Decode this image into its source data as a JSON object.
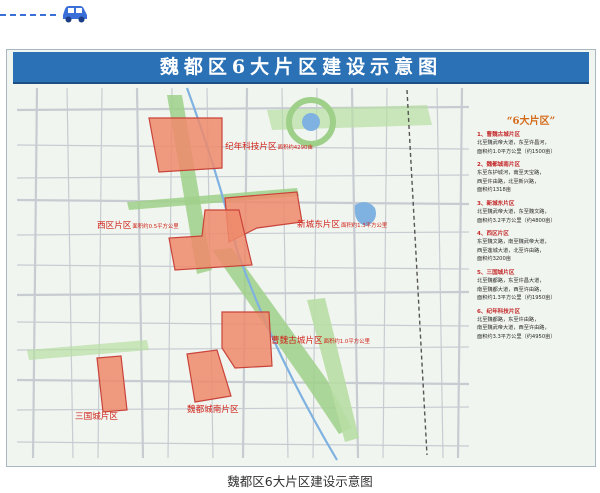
{
  "map": {
    "title": "魏都区6大片区建设示意图",
    "districts": [
      {
        "name": "纪年科技片区",
        "area_note": "面积约4290亩"
      },
      {
        "name": "西区片区",
        "area_note": "面积约0.5平方公里"
      },
      {
        "name": "新城东片区",
        "area_note": "面积约1.3平方公里"
      },
      {
        "name": "曹魏古城片区",
        "area_note": "面积约1.0平方公里"
      },
      {
        "name": "三国城片区",
        "area_note": ""
      },
      {
        "name": "魏都城南片区",
        "area_note": ""
      }
    ],
    "legend": {
      "title": "“6大片区”",
      "items": [
        {
          "name": "1、曹魏古城片区",
          "lines": [
            "北至魏武帝大道，东至许昌河，",
            "面积约1.0平方公里（约1500亩）"
          ]
        },
        {
          "name": "2、魏都城南片区",
          "lines": [
            "东至东护城河，南至天宝路，",
            "西至许由路，北至新兴路，",
            "面积约1318亩"
          ]
        },
        {
          "name": "3、新城东片区",
          "lines": [
            "北至魏武帝大道，东至魏文路，",
            "面积约3.2平方公里（约4800亩）"
          ]
        },
        {
          "name": "4、西区片区",
          "lines": [
            "东至魏文路，南至魏武帝大道，",
            "西至莲城大道，北至许由路，",
            "面积约3200亩"
          ]
        },
        {
          "name": "5、三国城片区",
          "lines": [
            "北至魏都路，东至许昌大道，",
            "南至魏都大道，西至许由路，",
            "面积约1.3平方公里（约1950亩）"
          ]
        },
        {
          "name": "6、纪年科技片区",
          "lines": [
            "北至魏都路，东至许由路，",
            "南至魏武帝大道，西至许由路，",
            "面积约3.3平方公里（约4950亩）"
          ]
        }
      ]
    },
    "colors": {
      "banner": "#2a71b6",
      "district_fill": "#ee8a6b",
      "district_stroke": "#c9433a",
      "district_label": "#d0231a",
      "green_belt": "#9fd08a",
      "water": "#7fb2e0",
      "map_background": "#f1f5ef"
    }
  },
  "caption": "魏都区6大片区建设示意图"
}
